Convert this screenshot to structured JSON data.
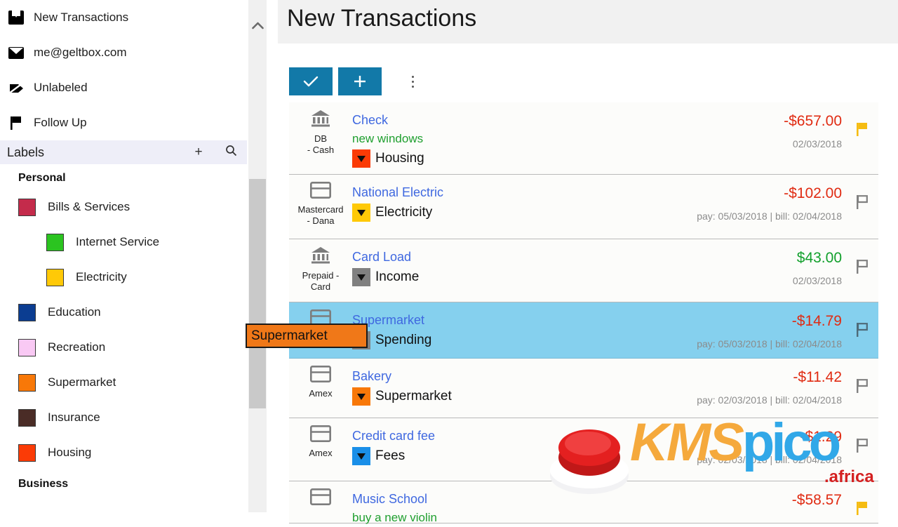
{
  "sidebar": {
    "nav": [
      {
        "label": "New Transactions",
        "icon": "inbox-icon"
      },
      {
        "label": "me@geltbox.com",
        "icon": "envelope-icon"
      },
      {
        "label": "Unlabeled",
        "icon": "tag-slash-icon"
      },
      {
        "label": "Follow Up",
        "icon": "flag-icon"
      }
    ],
    "labels_bar": {
      "title": "Labels",
      "add_label": "+",
      "search_icon": "search-icon"
    },
    "groups": [
      {
        "title": "Personal",
        "items": [
          {
            "label": "Bills & Services",
            "color": "#c42b4b",
            "indent": 0
          },
          {
            "label": "Internet Service",
            "color": "#2bc420",
            "indent": 1
          },
          {
            "label": "Electricity",
            "color": "#ffc907",
            "indent": 1
          },
          {
            "label": "Education",
            "color": "#0b3d91",
            "indent": 0
          },
          {
            "label": "Recreation",
            "color": "#f9c9f4",
            "indent": 0
          },
          {
            "label": "Supermarket",
            "color": "#f87808",
            "indent": 0
          },
          {
            "label": "Insurance",
            "color": "#4a2c26",
            "indent": 0
          },
          {
            "label": "Housing",
            "color": "#fb3b06",
            "indent": 0
          }
        ]
      },
      {
        "title": "Business",
        "items": []
      }
    ]
  },
  "scrollbar": {
    "up_arrow": "⌃"
  },
  "header": {
    "title": "New Transactions"
  },
  "toolbar": {
    "confirm_label": "✓",
    "add_label": "+",
    "more_label": "more-options"
  },
  "transactions": [
    {
      "account_icon": "bank-icon",
      "account": "DB\n- Cash",
      "payee": "Check",
      "note": "new  windows",
      "category": "Housing",
      "category_color": "#fb3b06",
      "amount": "-$657.00",
      "amount_sign": "neg",
      "date": "02/03/2018",
      "flag": "flagged",
      "flag_color": "#f5bc12",
      "selected": false
    },
    {
      "account_icon": "card-icon",
      "account": "Mastercard\n- Dana",
      "payee": "National Electric",
      "note": "",
      "category": "Electricity",
      "category_color": "#ffc907",
      "amount": "-$102.00",
      "amount_sign": "neg",
      "date": "pay: 05/03/2018 | bill: 02/04/2018",
      "flag": "unflagged",
      "flag_color": "#808080",
      "selected": false
    },
    {
      "account_icon": "bank-icon",
      "account": "Prepaid -\nCard",
      "payee": "Card Load",
      "note": "",
      "category": "Income",
      "category_color": "#808080",
      "amount": "$43.00",
      "amount_sign": "pos",
      "date": "02/03/2018",
      "flag": "unflagged",
      "flag_color": "#808080",
      "selected": false
    },
    {
      "account_icon": "card-icon",
      "account": "",
      "payee": "Supermarket",
      "note": "",
      "category": "Spending",
      "category_color": "#808080",
      "amount": "-$14.79",
      "amount_sign": "neg",
      "date": "pay: 05/03/2018 | bill: 02/04/2018",
      "flag": "unflagged",
      "flag_color": "#4e6a78",
      "selected": true
    },
    {
      "account_icon": "card-icon",
      "account": "Amex",
      "payee": "Bakery",
      "note": "",
      "category": "Supermarket",
      "category_color": "#f87808",
      "amount": "-$11.42",
      "amount_sign": "neg",
      "date": "pay: 02/03/2018 | bill: 02/04/2018",
      "flag": "unflagged",
      "flag_color": "#808080",
      "selected": false
    },
    {
      "account_icon": "card-icon",
      "account": "Amex",
      "payee": "Credit card fee",
      "note": "",
      "category": "Fees",
      "category_color": "#1a8fe8",
      "amount": "-$1.29",
      "amount_sign": "neg",
      "date": "pay: 02/03/2018 | bill: 02/04/2018",
      "flag": "unflagged",
      "flag_color": "#808080",
      "selected": false
    },
    {
      "account_icon": "card-icon",
      "account": "",
      "payee": "Music School",
      "note": "buy a new violin",
      "category": "",
      "category_color": "#f5bc12",
      "amount": "-$58.57",
      "amount_sign": "neg",
      "date": "",
      "flag": "flagged",
      "flag_color": "#f5bc12",
      "selected": false
    }
  ],
  "drag_chip": {
    "label": "Supermarket",
    "color": "#f07818"
  },
  "watermark": {
    "kms": "KMS",
    "pico": "pico",
    "africa": ".africa",
    "kms_color": "#f5a93c",
    "pico_color": "#31a8e8",
    "africa_color": "#d42020"
  }
}
